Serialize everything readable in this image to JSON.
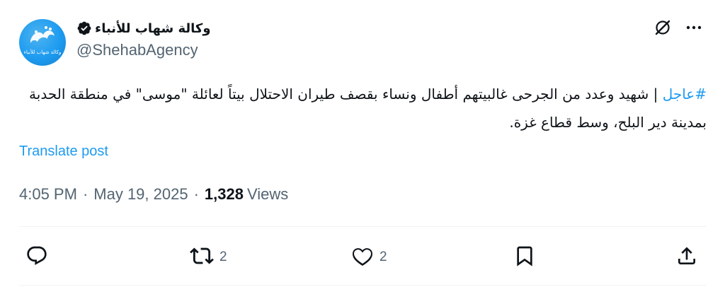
{
  "author": {
    "display_name": "وكالة شهاب للأنباء",
    "handle": "@ShehabAgency",
    "avatar_text": "وكالة شهاب للأنباء",
    "verified_icon": "verified-badge-icon"
  },
  "post": {
    "hashtag": "#عاجل",
    "text": " | شهيد وعدد من الجرحى غالبيتهم أطفال ونساء بقصف طيران الاحتلال بيتاً لعائلة \"موسى\" في منطقة الحدبة بمدينة دير البلح، وسط قطاع غزة.",
    "translate_label": "Translate post"
  },
  "meta": {
    "time": "4:05 PM",
    "separator": "·",
    "date": "May 19, 2025",
    "views_count": "1,328",
    "views_label": "Views"
  },
  "actions": {
    "reply_count": "",
    "repost_count": "2",
    "like_count": "2"
  },
  "colors": {
    "accent": "#1d9bf0",
    "secondary_text": "#536471",
    "primary_text": "#0f1419"
  }
}
